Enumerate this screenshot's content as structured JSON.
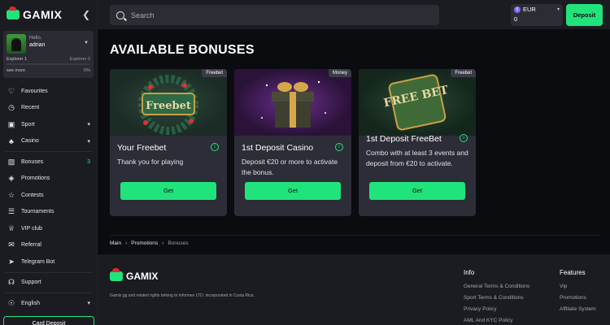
{
  "brand": {
    "name": "GAMIX",
    "accent": "#20e37c"
  },
  "user": {
    "greeting": "Hello,",
    "name": "adrian",
    "level_current": "Explorer 1",
    "level_next": "Explorer 2",
    "see_more": "see more",
    "progress_percent": "0%",
    "progress_value": 0
  },
  "sidebar": {
    "items": [
      {
        "label": "Favourites",
        "icon": "heart-icon"
      },
      {
        "label": "Recent",
        "icon": "clock-icon"
      },
      {
        "label": "Sport",
        "icon": "gamepad-icon",
        "has_caret": true
      },
      {
        "label": "Casino",
        "icon": "cherries-icon",
        "has_caret": true
      },
      {
        "label": "Bonuses",
        "icon": "gift-icon",
        "count": "3"
      },
      {
        "label": "Promotions",
        "icon": "tag-icon"
      },
      {
        "label": "Contests",
        "icon": "trophy-icon"
      },
      {
        "label": "Tournaments",
        "icon": "network-icon"
      },
      {
        "label": "VIP club",
        "icon": "crown-icon"
      },
      {
        "label": "Referral",
        "icon": "megaphone-icon"
      },
      {
        "label": "Telegram Bot",
        "icon": "telegram-icon"
      },
      {
        "label": "Support",
        "icon": "headset-icon"
      },
      {
        "label": "English",
        "icon": "globe-icon",
        "has_caret": true
      }
    ],
    "card_deposit": "Card Deposit"
  },
  "topbar": {
    "search_placeholder": "Search",
    "currency": "EUR",
    "balance": "0",
    "deposit_label": "Deposit"
  },
  "main": {
    "title": "AVAILABLE BONUSES",
    "bonuses": [
      {
        "badge": "Freebet",
        "image_text": "Freebet",
        "title": "Your Freebet",
        "description": "Thank you for playing",
        "button": "Get"
      },
      {
        "badge": "Money",
        "image_text": "",
        "title": "1st Deposit Casino",
        "description": "Deposit €20 or more to activate the bonus.",
        "button": "Get"
      },
      {
        "badge": "Freebet",
        "image_text": "FREE BET",
        "title": "1st Deposit FreeBet",
        "description": "Combo with at least 3 events and deposit from €20 to activate.",
        "button": "Get"
      }
    ],
    "breadcrumb": [
      "Main",
      "Promotions",
      "Bonuses"
    ]
  },
  "footer": {
    "legal": "Gamix.gg and related rights belong to Informex LTD, incorporated in Costa Rica.",
    "info_heading": "Info",
    "info_links": [
      "General Terms & Conditions",
      "Sport Terms & Conditions",
      "Privacy Policy",
      "AML And KYC Policy"
    ],
    "features_heading": "Features",
    "features_links": [
      "Vip",
      "Promotions",
      "Affiliate System"
    ]
  }
}
